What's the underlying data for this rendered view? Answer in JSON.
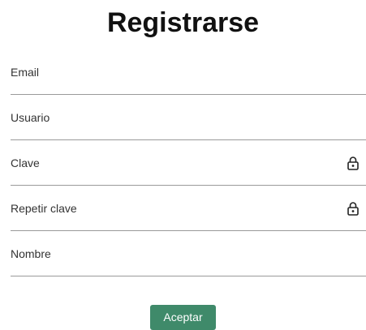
{
  "page": {
    "title": "Registrarse"
  },
  "form": {
    "fields": [
      {
        "placeholder": "Email",
        "value": "",
        "type": "email",
        "icon": null
      },
      {
        "placeholder": "Usuario",
        "value": "",
        "type": "text",
        "icon": null
      },
      {
        "placeholder": "Clave",
        "value": "",
        "type": "password",
        "icon": "lock-icon"
      },
      {
        "placeholder": "Repetir clave",
        "value": "",
        "type": "password",
        "icon": "lock-icon"
      },
      {
        "placeholder": "Nombre",
        "value": "",
        "type": "text",
        "icon": null
      }
    ],
    "submit_label": "Aceptar"
  },
  "colors": {
    "accent": "#3f8a6a",
    "divider": "#9a9a9a",
    "text": "#333333",
    "title": "#111111"
  }
}
